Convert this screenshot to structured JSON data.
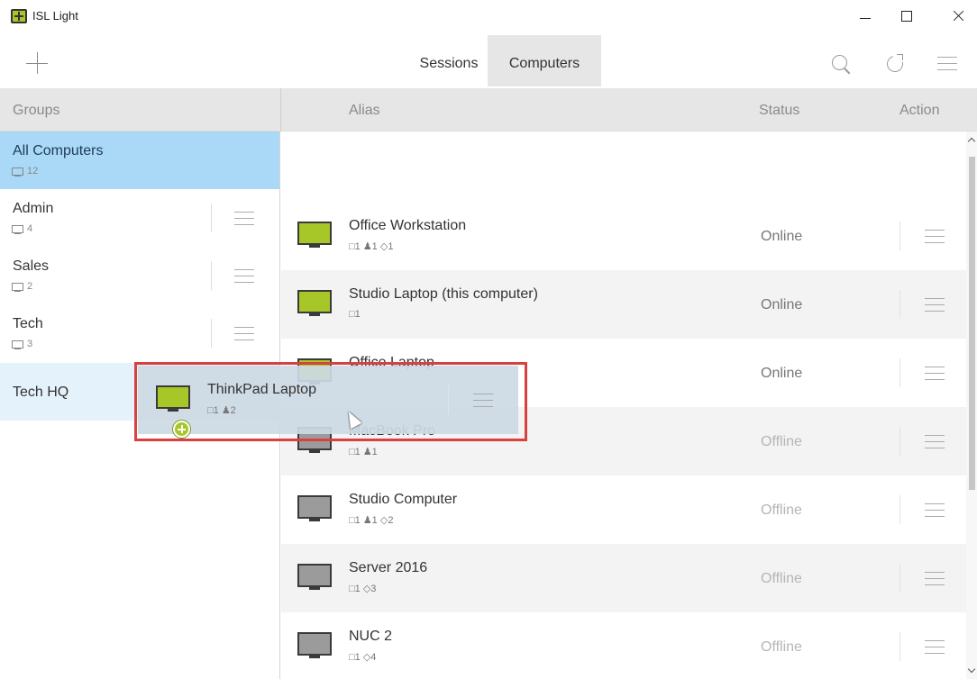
{
  "window": {
    "title": "ISL Light"
  },
  "tabs": [
    {
      "label": "Sessions",
      "active": false
    },
    {
      "label": "Computers",
      "active": true
    }
  ],
  "header": {
    "groups": "Groups",
    "alias": "Alias",
    "status": "Status",
    "action": "Action"
  },
  "groups": [
    {
      "name": "All Computers",
      "count": "12",
      "active": true
    },
    {
      "name": "Admin",
      "count": "4"
    },
    {
      "name": "Sales",
      "count": "2"
    },
    {
      "name": "Tech",
      "count": "3"
    },
    {
      "name": "Tech HQ",
      "count": ""
    }
  ],
  "computers": [
    {
      "alias": "Office Workstation",
      "meta": "□1 ♟1 ◇1",
      "status": "Online",
      "state": "online"
    },
    {
      "alias": "Studio Laptop (this computer)",
      "meta": "□1",
      "status": "Online",
      "state": "online"
    },
    {
      "alias": "Office Laptop",
      "meta": "",
      "status": "Online",
      "state": "online"
    },
    {
      "alias": "MacBook Pro",
      "meta": "□1 ♟1",
      "status": "Offline",
      "state": "offline"
    },
    {
      "alias": "Studio Computer",
      "meta": "□1 ♟1 ◇2",
      "status": "Offline",
      "state": "offline"
    },
    {
      "alias": "Server 2016",
      "meta": "□1 ◇3",
      "status": "Offline",
      "state": "offline"
    },
    {
      "alias": "NUC 2",
      "meta": "□1 ◇4",
      "status": "Offline",
      "state": "offline"
    }
  ],
  "drag": {
    "alias": "ThinkPad Laptop",
    "meta": "□1 ♟2"
  },
  "colors": {
    "online_screen": "#a7c729",
    "offline_screen": "#9b9b9b",
    "selected_group": "#a9d9f7",
    "drop_highlight": "#d94040"
  }
}
